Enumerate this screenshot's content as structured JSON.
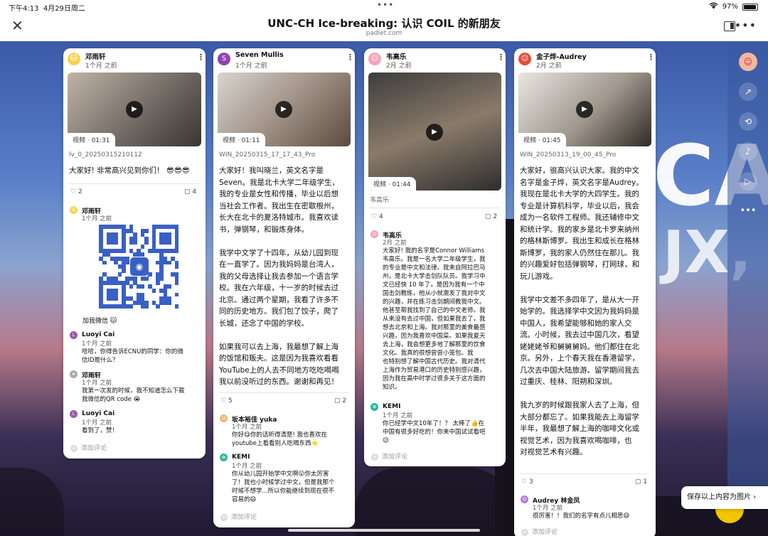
{
  "status": {
    "time": "下午4:13",
    "date": "4月29日周二",
    "battery": "97%",
    "battery_level": 0.97
  },
  "header": {
    "title": "UNC-CH Ice-breaking: 认识 COIL 的新朋友",
    "subtitle": "padlet.com"
  },
  "board_text": {
    "a": "CA",
    "b": "JX,"
  },
  "colors": {
    "accent": "#3a60c5",
    "fab": "#f3c400"
  },
  "posts": [
    {
      "author": "邓雨轩",
      "time": "1个月 之前",
      "video_label": "视频 · 01:31",
      "file": "lv_0_20250315210112",
      "body": "大家好! 非常高兴见到你们！ 😎😎😎",
      "likes": "2",
      "comments": "4",
      "qr_caption": "加我微信 🐱",
      "comment_list": [
        {
          "name": "邓雨轩",
          "time": "1个月 之前",
          "text": ""
        },
        {
          "name": "Luoyi Cai",
          "time": "1个月 之前",
          "text": "哈哈，你得告诉ECNU的同学：你的微\n信ID是什么？"
        },
        {
          "name": "邓雨轩",
          "time": "1个月 之前",
          "text": "我第一次发的时候，我不知道怎么下载\n我微信的QR code 😭"
        },
        {
          "name": "Luoyi Cai",
          "time": "1个月 之前",
          "text": "看到了，赞！"
        }
      ],
      "add_comment": "添加评论"
    },
    {
      "author": "Seven Mullis",
      "time": "1个月 之前",
      "video_label": "视频 · 01:11",
      "file": "WIN_20250315_17_17_43_Pro",
      "body": "大家好！我叫晓兰，英文名字是\nSeven。我是北卡大学二年级学生，\n我的专业是女性和传播，毕业以后想\n当社会工作者。我出生在密歇根州，\n长大在北卡的夏洛特城市。我喜欢读\n书，弹钢琴，和锻炼身体。\n\n我学中文学了十四年，从幼儿园到现\n在一直学了。因为我妈妈是台湾人，\n我的父母选择让我去参加一个语言学\n校。我在六年级，十一岁的时候去过\n北京。通过两个星期，我看了许多不\n同的历史地方。我们包了饺子，爬了\n长城，还念了中国的学校。\n\n如果我可以去上海，我最想了解上海\n的饭馆和贩夫。这是因为我喜欢看看\nYouTube上的人去不同地方吃吃喝喝\n我以前没听过的东西。谢谢和再见！",
      "likes": "5",
      "comments": "2",
      "comment_list": [
        {
          "name": "坂本裕佳 yuka",
          "time": "1个月 之前",
          "text": "你好😋你的话听得清楚! 我也喜欢在\nyoutube上看看别人吃喝东西⭐"
        },
        {
          "name": "KEMI",
          "time": "1个月 之前",
          "text": "你从幼儿园开始学中文啊😮你太厉害\n了！我也小时候学过中文，但是我那个\n时候不想学...所以你能继续到现在很不\n容易的😄"
        }
      ],
      "add_comment": "添加评论"
    },
    {
      "author": "韦高乐",
      "time": "2月 之前",
      "video_label": "视频 · 01:44",
      "file": "韦高乐",
      "likes": "4",
      "comments": "2",
      "comment_list": [
        {
          "name": "韦高乐",
          "time": "2月 之前",
          "text": "大家好! 我的名字是Connor Williams\n韦高乐。我是一名大学二年级学生，我\n的专业是中文和法律。我来自阿拉巴马\n州，是北卡大学击剑队队员。我学习中\n文已经快 10 年了，是因为我有一个中\n国击剑教练，他从小就激发了我对中文\n的兴趣，并在练习击剑期间教我中文。\n他甚至帮我找到了自己的中文老师。我\n从来没有去过中国，但如果我去了，我\n想去北京和上海。我对那里的美食最感\n兴趣，因为我喜欢中国菜。如果我夏天\n去上海，我会想更多地了解那里的饮食\n文化。我真的很想尝尝小笼包。我\n也特别想了解中国古代历史。我对清代\n上海作为贸易港口的历史特别感兴趣，\n因为我在高中时学过很多关于这方面的\n知识。"
        },
        {
          "name": "KEMI",
          "time": "1个月 之前",
          "text": "你已经学中文10年了！？ 太棒了👍在\n中国有很多好吃的！你来中国试试看吧\n😉"
        }
      ],
      "add_comment": "添加评论"
    },
    {
      "author": "金子烨-Audrey",
      "time": "2月 之前",
      "video_label": "视频 · 01:45",
      "file": "WIN_20250313_19_00_45_Pro",
      "body": "大家好，很高兴认识大家。我的中文\n名字是金子烨，英文名字是Audrey。\n我现在是北卡大学的大四学生。我的\n专业是计算机科学，毕业以后，我会\n成为一名软件工程师。我还辅修中文\n和统计学。我的家乡是北卡罗来纳州\n的格林斯博罗。我出生和成长在格林\n斯博罗，我的家人仍然住在那儿。我\n的兴趣爱好包括弹钢琴，打网球，和\n玩儿游戏。\n\n我学中文差不多四年了，是从大一开\n始学的。我选择学中文因为我妈妈是\n中国人，我希望能够和她的家人交\n流。小时候，我去过中国几次，看望\n姥姥姥爷和舅舅舅妈。他们都住在北\n京。另外，上个春天我在香港留学，\n几次去中国大陆旅游。留学期间我去\n过重庆、桂林、阳朔和深圳。\n\n我九岁的时候跟我家人去了上海，但\n大部分都忘了。如果我能去上海留学\n半年，我最想了解上海的咖啡文化或\n视觉艺术，因为我喜欢喝咖啡，也\n对视觉艺术有兴趣。",
      "likes": "3",
      "comments": "1",
      "comment_list": [
        {
          "name": "Audrey 林金凤",
          "time": "1个月 之前",
          "text": "很厉害！！我们的名字有点儿相思😄"
        }
      ],
      "add_comment": "添加评论"
    }
  ],
  "toast": "保存以上内容为图片 ›"
}
